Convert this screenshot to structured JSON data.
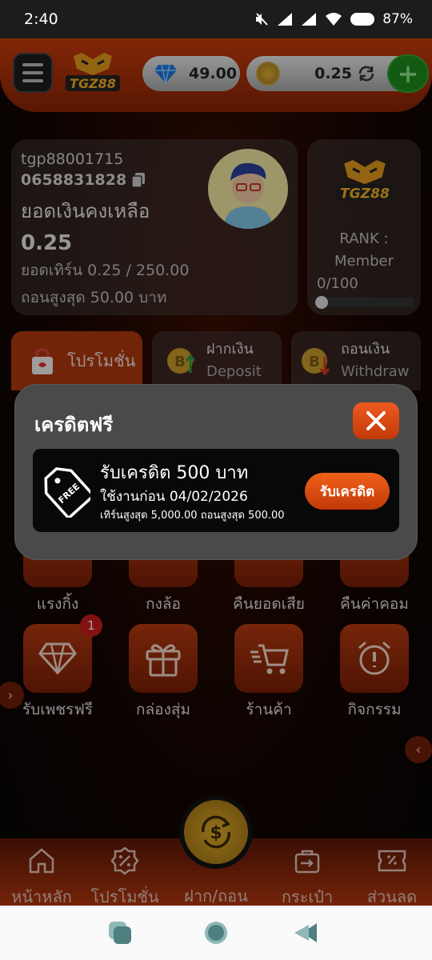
{
  "status_bar": {
    "time": "2:40",
    "battery": "87%"
  },
  "header": {
    "gems": "49.00",
    "credit": "0.25",
    "add_symbol": "+"
  },
  "logo_text": "TGZ88",
  "account": {
    "username": "tgp88001715",
    "phone": "0658831828",
    "balance_label": "ยอดเงินคงเหลือ",
    "balance": "0.25",
    "turnover": "ยอดเทิร์น 0.25 / 250.00",
    "max_withdraw": "ถอนสูงสุด 50.00 บาท"
  },
  "rank": {
    "label": "RANK :",
    "tier": "Member",
    "progress_text": "0/100",
    "progress": 0
  },
  "tabs": [
    {
      "label": "โปรโมชั่น",
      "sub": ""
    },
    {
      "label": "ฝากเงิน",
      "sub": "Deposit"
    },
    {
      "label": "ถอนเงิน",
      "sub": "Withdraw"
    }
  ],
  "menu_row1": [
    "แรงกิ้ง",
    "กงล้อ",
    "คืนยอดเสีย",
    "คืนค่าคอม"
  ],
  "menu_row2": [
    "รับเพชรฟรี",
    "กล่องสุ่ม",
    "ร้านค้า",
    "กิจกรรม"
  ],
  "badge_count": "1",
  "bottom_nav": [
    "หน้าหลัก",
    "โปรโมชั่น",
    "ฝาก/ถอน",
    "กระเป๋า",
    "ส่วนลด"
  ],
  "modal": {
    "title": "เครดิตฟรี",
    "offer_title": "รับเครดิต 500 บาท",
    "offer_expiry": "ใช้งานก่อน 04/02/2026",
    "offer_limits": "เทิร์นสูงสุด 5,000.00 ถอนสูงสุด 500.00",
    "claim_label": "รับเครดิต",
    "tag_text": "FREE"
  }
}
